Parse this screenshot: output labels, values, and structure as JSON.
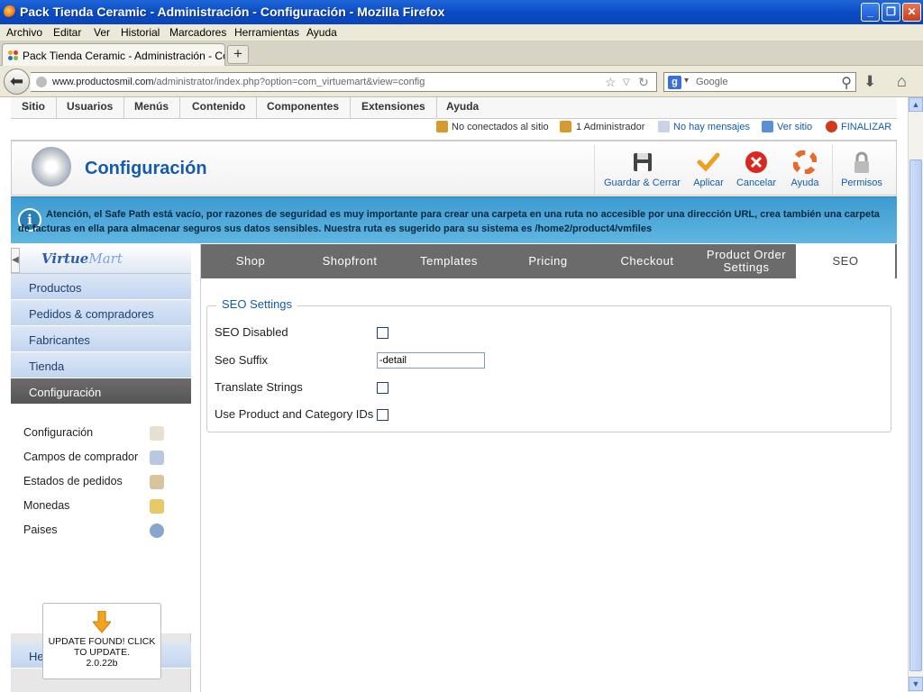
{
  "window": {
    "title": "Pack Tienda Ceramic - Administración - Configuración - Mozilla Firefox"
  },
  "menu": [
    "Archivo",
    "Editar",
    "Ver",
    "Historial",
    "Marcadores",
    "Herramientas",
    "Ayuda"
  ],
  "browser_tab": {
    "title": "Pack Tienda Ceramic - Administración - Confi...",
    "new_tab": "+"
  },
  "address": {
    "host": "www.productosmil.com",
    "path": "/administrator/index.php?option=com_virtuemart&view=config"
  },
  "search": {
    "engine": "g",
    "placeholder": "Google"
  },
  "admin_menu": [
    "Sitio",
    "Usuarios",
    "Menús",
    "Contenido",
    "Componentes",
    "Extensiones",
    "Ayuda"
  ],
  "status": {
    "online": "No conectados al sitio",
    "admins": "1 Administrador",
    "messages": "No hay mensajes",
    "view_site": "Ver sitio",
    "logout": "FINALIZAR"
  },
  "toolbar": {
    "page_title": "Configuración",
    "buttons": [
      "Guardar & Cerrar",
      "Aplicar",
      "Cancelar",
      "Ayuda",
      "Permisos"
    ]
  },
  "alert": {
    "icon": "i",
    "text": "Atención, el Safe Path está vacío, por razones de seguridad es muy importante para crear una carpeta en una ruta no accesible por una dirección URL, crea también una carpeta de facturas en ella para almacenar seguros sus datos sensibles. Nuestra ruta es sugerido para su sistema es /home2/product4/vmfiles"
  },
  "sidebar": {
    "logo_main": "Virtue",
    "logo_accent": "Mart",
    "nav": [
      "Productos",
      "Pedidos & compradores",
      "Fabricantes",
      "Tienda",
      "Configuración"
    ],
    "sub": [
      "Configuración",
      "Campos de comprador",
      "Estados de pedidos",
      "Monedas",
      "Paises"
    ],
    "tools": "Herramientas",
    "update": {
      "line1": "UPDATE FOUND! CLICK",
      "line2": "TO UPDATE.",
      "version": "2.0.22b"
    }
  },
  "tabs": [
    "Shop",
    "Shopfront",
    "Templates",
    "Pricing",
    "Checkout",
    "Product Order Settings",
    "SEO"
  ],
  "seo": {
    "legend": "SEO Settings",
    "disabled_label": "SEO Disabled",
    "suffix_label": "Seo Suffix",
    "suffix_value": "-detail",
    "translate_label": "Translate Strings",
    "ids_label": "Use Product and Category IDs"
  },
  "icons": {
    "firefox": "firefox-icon",
    "back": "back-arrow-icon",
    "star": "star-icon",
    "reload": "reload-icon",
    "search": "magnifier-icon",
    "download": "download-icon",
    "home": "home-icon",
    "save": "floppy-icon",
    "apply": "checkmark-icon",
    "cancel": "cancel-icon",
    "help": "lifebuoy-icon",
    "permissions": "lock-icon"
  }
}
